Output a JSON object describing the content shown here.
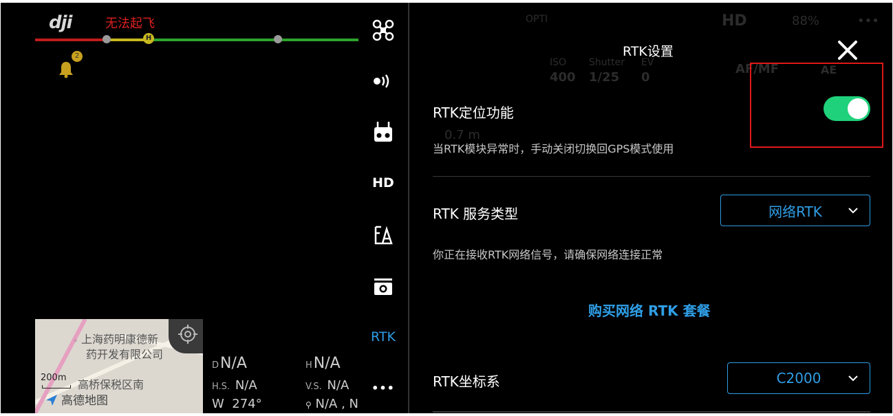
{
  "flight_view": {
    "logo": "dji",
    "flight_status": "无法起飞",
    "waypoint_home_label": "H",
    "notification_count": "2",
    "map": {
      "poi_line1": "上海药明康德新",
      "poi_line2": "药开发有限公司",
      "area_label": "高桥保税区南",
      "scale": "200m",
      "provider": "高德地图"
    },
    "telemetry": {
      "d_key": "D",
      "d_value": "N/A",
      "h_key": "H",
      "h_value": "N/A",
      "hs_key": "H.S.",
      "hs_value": "N/A",
      "vs_key": "V.S.",
      "vs_value": "N/A",
      "heading_key": "W",
      "heading_value": "274°",
      "location_value": "N/A , N"
    }
  },
  "background_hud": {
    "opti": "OPTI",
    "hd": "HD",
    "battery": "88%",
    "iso_label": "ISO",
    "iso_value": "400",
    "shutter_label": "Shutter",
    "shutter_value": "1/25",
    "ev_label": "EV",
    "ev_value": "0",
    "focus": "AF/MF",
    "ae": "AE",
    "altitude": "0.7 m"
  },
  "side_menu": {
    "items": [
      {
        "name": "aircraft",
        "icon": "drone-icon"
      },
      {
        "name": "sensing",
        "icon": "radar-icon"
      },
      {
        "name": "remote-controller",
        "icon": "remote-controller-icon"
      },
      {
        "name": "hd",
        "label": "HD"
      },
      {
        "name": "battery",
        "icon": "battery-settings-icon"
      },
      {
        "name": "camera",
        "icon": "camera-icon"
      },
      {
        "name": "rtk",
        "label": "RTK",
        "active": true
      },
      {
        "name": "more",
        "label": "•••"
      }
    ]
  },
  "rtk_panel": {
    "title": "RTK设置",
    "positioning_label": "RTK定位功能",
    "positioning_enabled": true,
    "positioning_desc": "当RTK模块异常时，手动关闭切换回GPS模式使用",
    "service_type_label": "RTK 服务类型",
    "service_type_value": "网络RTK",
    "service_type_desc": "你正在接收RTK网络信号，请确保网络连接正常",
    "buy_link": "购买网络 RTK 套餐",
    "coord_system_label": "RTK坐标系",
    "coord_system_value": "C2000"
  },
  "colors": {
    "accent": "#2f9ee6",
    "toggle_on": "#1fd17a",
    "warning": "#e02020",
    "highlight_box": "#e01818"
  }
}
